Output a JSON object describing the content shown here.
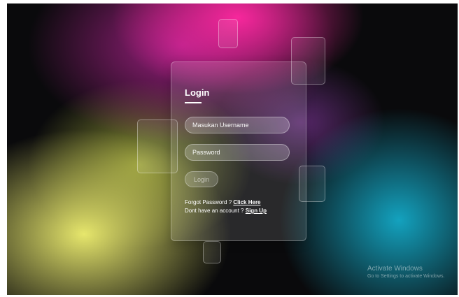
{
  "login": {
    "title": "Login",
    "username_placeholder": "Masukan Username",
    "password_placeholder": "Password",
    "button_label": "Login",
    "forgot_text": "Forgot Password ?",
    "forgot_link": "Click Here",
    "signup_text": "Dont have an account ?",
    "signup_link": "Sign Up"
  },
  "watermark": {
    "line1": "Activate Windows",
    "line2": "Go to Settings to activate Windows."
  },
  "colors": {
    "pink": "#ff28a0",
    "yellow": "#ebeb6e",
    "cyan": "#14aac8",
    "background": "#0a0a0c"
  }
}
